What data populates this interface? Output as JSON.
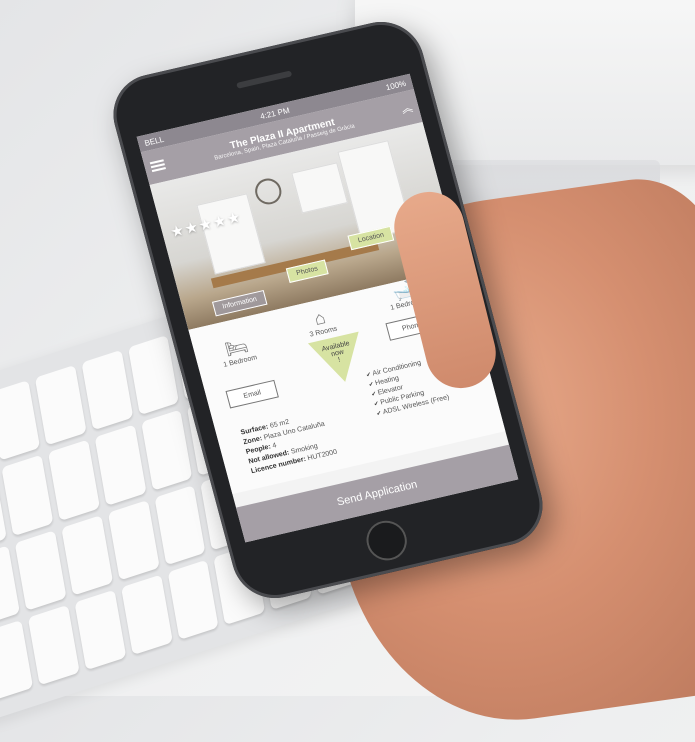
{
  "status": {
    "carrier": "BELL",
    "time": "4:21 PM",
    "battery": "100%"
  },
  "header": {
    "title": "The Plaza II Apartment",
    "subtitle": "Barcelona, Spain, Plaza Cataluña / Passeig de Gràcia"
  },
  "rating": {
    "stars": "★★★★★",
    "value": 5,
    "max": 5
  },
  "tabs": {
    "information": "Information",
    "photos": "Photos",
    "location": "Location"
  },
  "amenities": {
    "bedrooms_left": "1 Bedroom",
    "rooms": "3 Rooms",
    "bedrooms_right": "1 Bedroom"
  },
  "buttons": {
    "email": "Email",
    "phone": "Phone",
    "send": "Send Application"
  },
  "availability": {
    "line1": "Available",
    "line2": "now",
    "line3": "!"
  },
  "facts": {
    "surface_label": "Surface:",
    "surface_value": "65 m2",
    "zone_label": "Zone:",
    "zone_value": "Plaza Uno Cataluña",
    "people_label": "People:",
    "people_value": "4",
    "not_allowed_label": "Not allowed:",
    "not_allowed_value": "Smoking",
    "licence_label": "Licence number:",
    "licence_value": "HUT2000"
  },
  "features": [
    "Air Conditioning",
    "Heating",
    "Elevator",
    "Public Parking",
    "ADSL Wireless (Free)"
  ],
  "colors": {
    "accent": "#a59fa6",
    "highlight": "#d7e3a2"
  }
}
